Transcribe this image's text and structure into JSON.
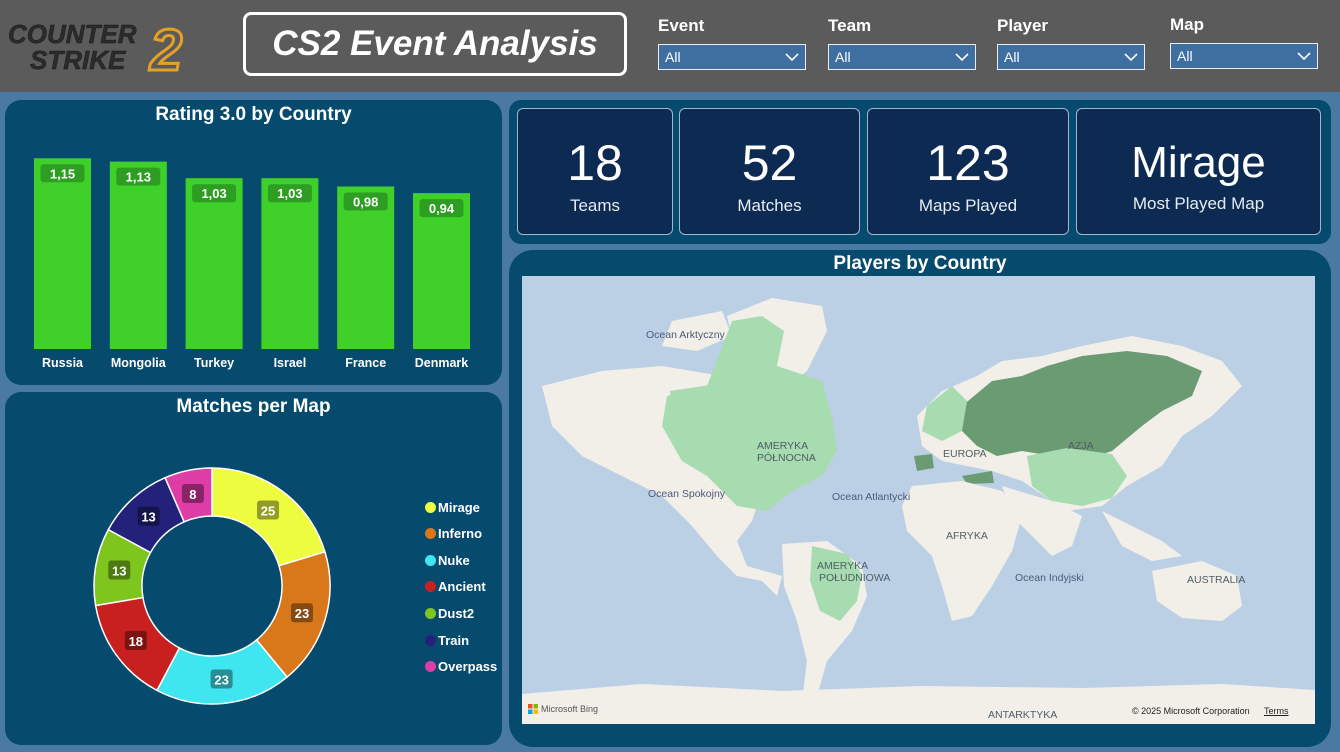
{
  "header": {
    "logo_line1": "COUNTER",
    "logo_line2": "STRIKE",
    "logo_number": "2",
    "title": "CS2 Event Analysis"
  },
  "filters": [
    {
      "label": "Event",
      "value": "All"
    },
    {
      "label": "Team",
      "value": "All"
    },
    {
      "label": "Player",
      "value": "All"
    },
    {
      "label": "Map",
      "value": "All"
    }
  ],
  "kpis": [
    {
      "value": "18",
      "label": "Teams"
    },
    {
      "value": "52",
      "label": "Matches"
    },
    {
      "value": "123",
      "label": "Maps Played"
    },
    {
      "value": "Mirage",
      "label": "Most Played Map"
    }
  ],
  "rating_chart": {
    "title": "Rating 3.0 by Country",
    "bar_color": "#3fd12a"
  },
  "donut_chart": {
    "title": "Matches per Map"
  },
  "map_panel": {
    "title": "Players by Country",
    "labels": {
      "arctic": "Ocean Arktyczny",
      "north_america": "AMERYKA",
      "north_america_2": "PÓŁNOCNA",
      "europe": "EUROPA",
      "asia": "AZJA",
      "pacific": "Ocean Spokojny",
      "atlantic": "Ocean Atlantycki",
      "africa": "AFRYKA",
      "south_america": "AMERYKA",
      "south_america_2": "POŁUDNIOWA",
      "indian": "Ocean Indyjski",
      "australia": "AUSTRALIA",
      "antarctica": "ANTARKTYKA"
    },
    "attribution": "Microsoft Bing",
    "copyright": "© 2025 Microsoft Corporation",
    "terms": "Terms"
  },
  "chart_data": [
    {
      "type": "bar",
      "title": "Rating 3.0 by Country",
      "categories": [
        "Russia",
        "Mongolia",
        "Turkey",
        "Israel",
        "France",
        "Denmark"
      ],
      "values": [
        1.15,
        1.13,
        1.03,
        1.03,
        0.98,
        0.94
      ],
      "value_labels": [
        "1,15",
        "1,13",
        "1,03",
        "1,03",
        "0,98",
        "0,94"
      ],
      "xlabel": "",
      "ylabel": "",
      "ylim": [
        0,
        1.2
      ],
      "grid": false
    },
    {
      "type": "pie",
      "title": "Matches per Map",
      "series": [
        {
          "name": "Mirage",
          "value": 25,
          "color": "#eefc3f"
        },
        {
          "name": "Inferno",
          "value": 23,
          "color": "#d8781a"
        },
        {
          "name": "Nuke",
          "value": 23,
          "color": "#3fe6ef"
        },
        {
          "name": "Ancient",
          "value": 18,
          "color": "#c8201f"
        },
        {
          "name": "Dust2",
          "value": 13,
          "color": "#7ec51d"
        },
        {
          "name": "Train",
          "value": 13,
          "color": "#23217a"
        },
        {
          "name": "Overpass",
          "value": 8,
          "color": "#de3ca6"
        }
      ],
      "legend": "right"
    }
  ]
}
